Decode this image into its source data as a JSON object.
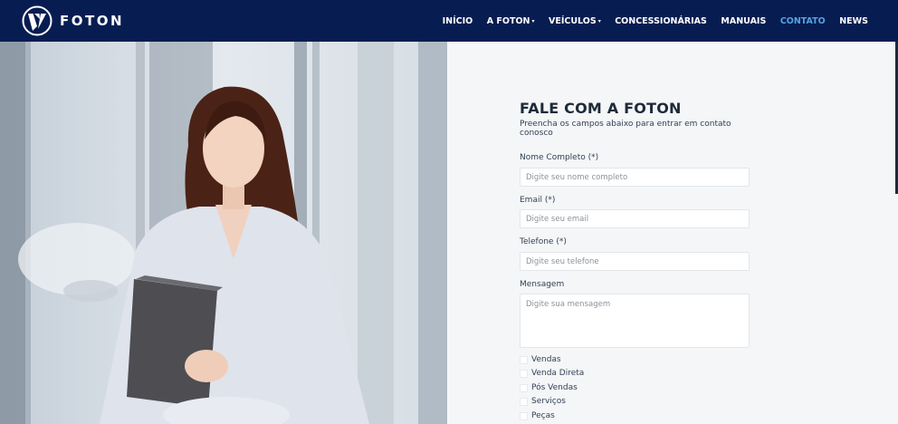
{
  "brand": {
    "name": "FOTON"
  },
  "nav": {
    "items": [
      {
        "label": "INÍCIO",
        "dropdown": false,
        "active": false
      },
      {
        "label": "A FOTON",
        "dropdown": true,
        "active": false
      },
      {
        "label": "VEÍCULOS",
        "dropdown": true,
        "active": false
      },
      {
        "label": "CONCESSIONÁRIAS",
        "dropdown": false,
        "active": false
      },
      {
        "label": "MANUAIS",
        "dropdown": false,
        "active": false
      },
      {
        "label": "CONTATO",
        "dropdown": false,
        "active": true
      },
      {
        "label": "NEWS",
        "dropdown": false,
        "active": false
      }
    ],
    "caret": "▾"
  },
  "form": {
    "title": "FALE COM A FOTON",
    "subtitle": "Preencha os campos abaixo para entrar em contato conosco",
    "fields": {
      "name": {
        "label": "Nome Completo (*)",
        "placeholder": "Digite seu nome completo",
        "value": ""
      },
      "email": {
        "label": "Email (*)",
        "placeholder": "Digite seu email",
        "value": ""
      },
      "phone": {
        "label": "Telefone (*)",
        "placeholder": "Digite seu telefone",
        "value": ""
      },
      "message": {
        "label": "Mensagem",
        "placeholder": "Digite sua mensagem",
        "value": ""
      }
    },
    "options": [
      {
        "label": "Vendas",
        "checked": false
      },
      {
        "label": "Venda Direta",
        "checked": false
      },
      {
        "label": "Pós Vendas",
        "checked": false
      },
      {
        "label": "Serviços",
        "checked": false
      },
      {
        "label": "Peças",
        "checked": false
      }
    ]
  },
  "colors": {
    "navbar": "#071d52",
    "active_link": "#56a3e0",
    "page_bg": "#f4f6f8"
  }
}
